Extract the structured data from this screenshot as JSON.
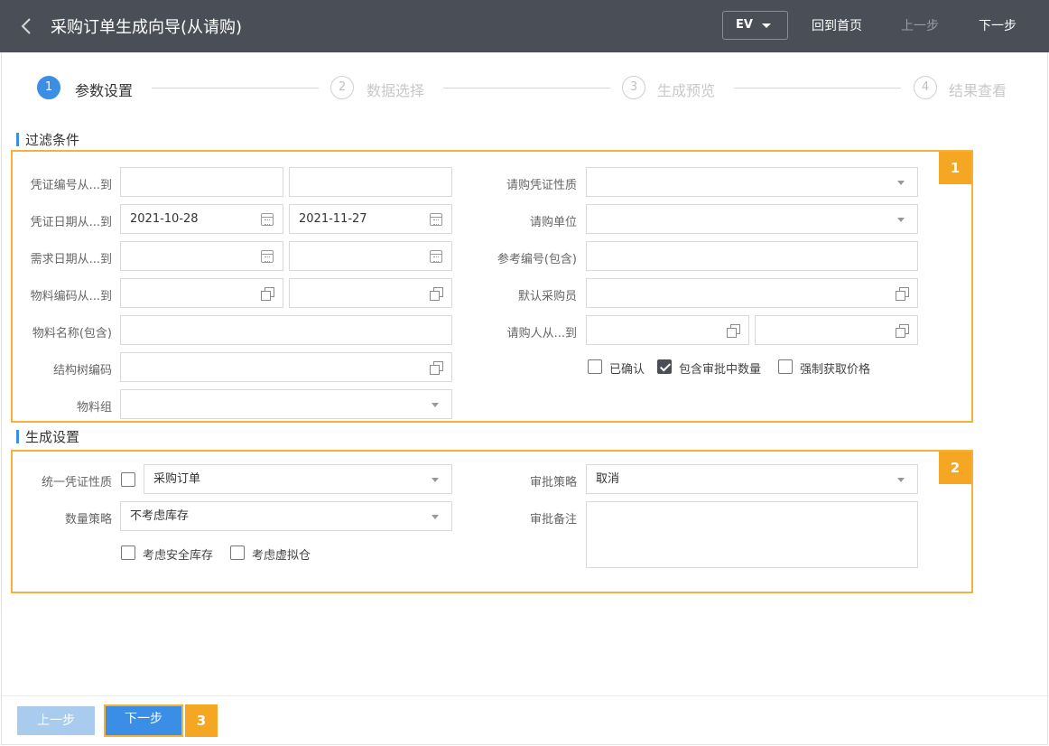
{
  "header": {
    "title": "采购订单生成向导(从请购)",
    "ev_label": "EV",
    "home_label": "回到首页",
    "prev_label": "上一步",
    "next_label": "下一步"
  },
  "steps": [
    {
      "num": "1",
      "label": "参数设置"
    },
    {
      "num": "2",
      "label": "数据选择"
    },
    {
      "num": "3",
      "label": "生成预览"
    },
    {
      "num": "4",
      "label": "结果查看"
    }
  ],
  "filter": {
    "section_title": "过滤条件",
    "badge": "1",
    "voucher_no_label": "凭证编号从...到",
    "voucher_date_label": "凭证日期从...到",
    "voucher_date_from": "2021-10-28",
    "voucher_date_to": "2021-11-27",
    "demand_date_label": "需求日期从...到",
    "material_code_label": "物料编码从...到",
    "material_name_label": "物料名称(包含)",
    "structure_tree_label": "结构树编码",
    "material_group_label": "物料组",
    "request_nature_label": "请购凭证性质",
    "request_unit_label": "请购单位",
    "ref_no_label": "参考编号(包含)",
    "default_buyer_label": "默认采购员",
    "requester_label": "请购人从...到",
    "confirmed_label": "已确认",
    "include_approving_label": "包含审批中数量",
    "force_price_label": "强制获取价格"
  },
  "generate": {
    "section_title": "生成设置",
    "badge": "2",
    "unify_nature_label": "统一凭证性质",
    "unify_nature_value": "采购订单",
    "qty_strategy_label": "数量策略",
    "qty_strategy_value": "不考虑库存",
    "safety_stock_label": "考虑安全库存",
    "virtual_warehouse_label": "考虑虚拟仓",
    "approval_strategy_label": "审批策略",
    "approval_strategy_value": "取消",
    "approval_note_label": "审批备注"
  },
  "footer": {
    "prev_label": "上一步",
    "next_label": "下一步",
    "badge": "3"
  }
}
